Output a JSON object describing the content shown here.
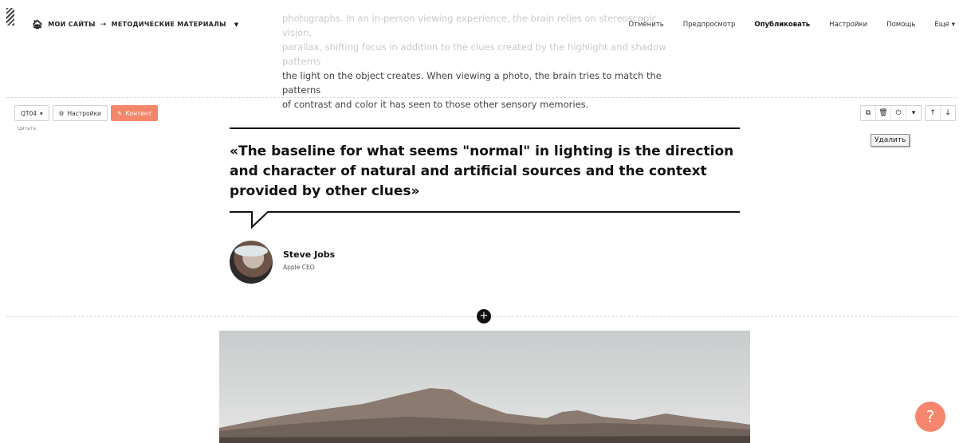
{
  "header": {
    "breadcrumb_sites": "МОИ САЙТЫ",
    "breadcrumb_arrow": "→",
    "breadcrumb_page": "МЕТОДИЧЕСКИЕ МАТЕРИАЛЫ",
    "menu": {
      "cancel": "Отменить",
      "preview": "Предпросмотр",
      "publish": "Опубликовать",
      "settings": "Настройки",
      "help": "Помощь",
      "more": "Еще"
    }
  },
  "intro": {
    "line1": "photographs. In an in-person viewing experience, the brain relies on stereoscopic vision,",
    "line2": "parallax, shifting focus in addition to the clues created by the highlight and shadow patterns",
    "line3": "the light on the object creates. When viewing a photo, the brain tries to match the patterns",
    "line4": "of contrast and color it has seen to those other sensory memories."
  },
  "block_toolbar": {
    "block_code": "QT04",
    "settings_label": "Настройки",
    "content_label": "Контент",
    "block_type": "Цитата",
    "tooltip": "Удалить"
  },
  "quote": {
    "text": "«The baseline for what seems \"normal\" in lighting is the direction and character of natural and artificial sources and the context provided by other clues»",
    "author_name": "Steve Jobs",
    "author_role": "Apple CEO"
  },
  "add_button_label": "+",
  "help_button_label": "?",
  "colors": {
    "accent": "#f4866a",
    "text": "#111111",
    "dash": "#d6d6d6"
  }
}
